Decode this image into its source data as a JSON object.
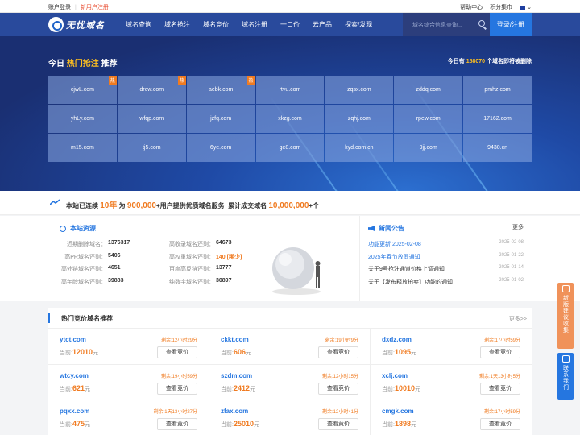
{
  "topbar": {
    "login": "账户登录",
    "register": "新用户注册",
    "help": "帮助中心",
    "points": "积分集市"
  },
  "nav": {
    "logo_text": "无忧域名",
    "items": [
      "域名查询",
      "域名抢注",
      "域名竞价",
      "域名注册",
      "一口价",
      "云产品",
      "探索/发现"
    ],
    "search_placeholder": "域名综合信息查询...",
    "login_button": "登录/注册"
  },
  "hero": {
    "title_prefix": "今日",
    "title_highlight": "热门抢注",
    "title_suffix": "推荐",
    "right_prefix": "今日有",
    "right_count": "158070",
    "right_suffix": "个域名即将被删除",
    "hot_badge": "热",
    "domains": [
      {
        "name": "cjwL.com",
        "hot": true
      },
      {
        "name": "drcw.com",
        "hot": true
      },
      {
        "name": "aebk.com",
        "hot": true
      },
      {
        "name": "rtvu.com",
        "hot": false
      },
      {
        "name": "zqsx.com",
        "hot": false
      },
      {
        "name": "zddq.com",
        "hot": false
      },
      {
        "name": "pmhz.com",
        "hot": false
      },
      {
        "name": "yhLy.com",
        "hot": false
      },
      {
        "name": "wfqp.com",
        "hot": false
      },
      {
        "name": "jzfq.com",
        "hot": false
      },
      {
        "name": "xkzg.com",
        "hot": false
      },
      {
        "name": "zqhj.com",
        "hot": false
      },
      {
        "name": "rpew.com",
        "hot": false
      },
      {
        "name": "17162.com",
        "hot": false
      },
      {
        "name": "m15.com",
        "hot": false
      },
      {
        "name": "tj5.com",
        "hot": false
      },
      {
        "name": "6ye.com",
        "hot": false
      },
      {
        "name": "ge8.com",
        "hot": false
      },
      {
        "name": "kyd.com.cn",
        "hot": false
      },
      {
        "name": "9jj.com",
        "hot": false
      },
      {
        "name": "9430.cn",
        "hot": false
      }
    ]
  },
  "strip": {
    "p1": "本站已连续",
    "years": "10年",
    "p2": "为",
    "users": "900,000",
    "p3": "+用户提供优质域名服务",
    "p4": "累计成交域名",
    "deals": "10,000,000",
    "p5": "+个"
  },
  "resources": {
    "title": "本站资源",
    "rows": [
      {
        "k1": "近期删除域名：",
        "v1": "1376317",
        "k2": "高收录域名还剩：",
        "v2": "64673",
        "v2_extra": ""
      },
      {
        "k1": "高PR域名还剩：",
        "v1": "5406",
        "k2": "高权重域名还剩：",
        "v2": "140",
        "v2_extra": "[稀少]"
      },
      {
        "k1": "高外链域名还剩：",
        "v1": "4651",
        "k2": "百度高反链还剩：",
        "v2": "13777",
        "v2_extra": ""
      },
      {
        "k1": "高年龄域名还剩：",
        "v1": "39883",
        "k2": "纯数字域名还剩：",
        "v2": "30897",
        "v2_extra": ""
      }
    ]
  },
  "news": {
    "title": "新闻公告",
    "more": "更多",
    "items": [
      {
        "t": "功能更新 2025-02-08",
        "d": "2025-02-08",
        "blue": true
      },
      {
        "t": "2025年春节放假通知",
        "d": "2025-01-22",
        "blue": true
      },
      {
        "t": "关于9号抢注通道价格上调通知",
        "d": "2025-01-14",
        "blue": false
      },
      {
        "t": "关于【发布释放拍卖】功能的通知",
        "d": "2025-01-02",
        "blue": false
      }
    ]
  },
  "auction": {
    "title": "热门竞价域名推荐",
    "more": "更多>>",
    "price_prefix": "当前:",
    "price_unit": "元",
    "bid_button": "查看竞价",
    "items": [
      {
        "domain": "ytct.com",
        "remain": "剩余:12小时29分",
        "price": "12010"
      },
      {
        "domain": "ckkt.com",
        "remain": "剩余:19小时9分",
        "price": "606"
      },
      {
        "domain": "dxdz.com",
        "remain": "剩余:17小时59分",
        "price": "1095"
      },
      {
        "domain": "wtcy.com",
        "remain": "剩余:19小时59分",
        "price": "621"
      },
      {
        "domain": "szdm.com",
        "remain": "剩余:12小时15分",
        "price": "2412"
      },
      {
        "domain": "xclj.com",
        "remain": "剩余:1天13小时5分",
        "price": "10010"
      },
      {
        "domain": "pqxx.com",
        "remain": "剩余:1天13小时27分",
        "price": "475"
      },
      {
        "domain": "zfax.com",
        "remain": "剩余:12小时41分",
        "price": "25010"
      },
      {
        "domain": "cmgk.com",
        "remain": "剩余:17小时59分",
        "price": "1898"
      }
    ]
  },
  "side": {
    "feedback": "新版建议收集",
    "contact": "联系我们"
  },
  "colors": {
    "brand": "#294a9c",
    "accent": "#2576e0",
    "orange": "#f07b21",
    "highlight": "#ffc01f"
  }
}
